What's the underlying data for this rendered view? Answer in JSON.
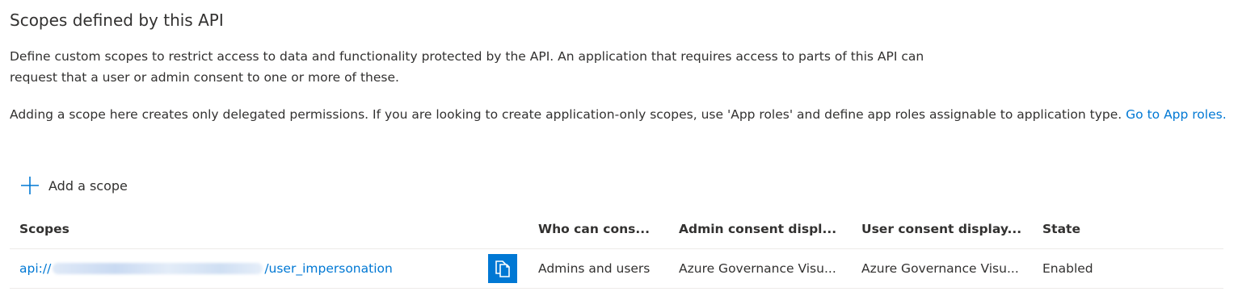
{
  "section": {
    "title": "Scopes defined by this API",
    "description_1": "Define custom scopes to restrict access to data and functionality protected by the API. An application that requires access to parts of this API can request that a user or admin consent to one or more of these.",
    "description_2": "Adding a scope here creates only delegated permissions. If you are looking to create application-only scopes, use 'App roles' and define app roles assignable to application type.",
    "app_roles_link": "Go to App roles."
  },
  "toolbar": {
    "add_scope_label": "Add a scope",
    "add_icon": "plus-icon"
  },
  "table": {
    "columns": [
      "Scopes",
      "Who can cons...",
      "Admin consent displ...",
      "User consent display...",
      "State"
    ],
    "rows": [
      {
        "scope_prefix": "api://",
        "scope_suffix": "/user_impersonation",
        "who": "Admins and users",
        "admin": "Azure Governance Visu...",
        "user": "Azure Governance Visu...",
        "state": "Enabled",
        "copy_icon": "copy-icon"
      }
    ]
  },
  "colors": {
    "accent": "#0078d4",
    "text": "#323130",
    "divider": "#edebe9"
  }
}
